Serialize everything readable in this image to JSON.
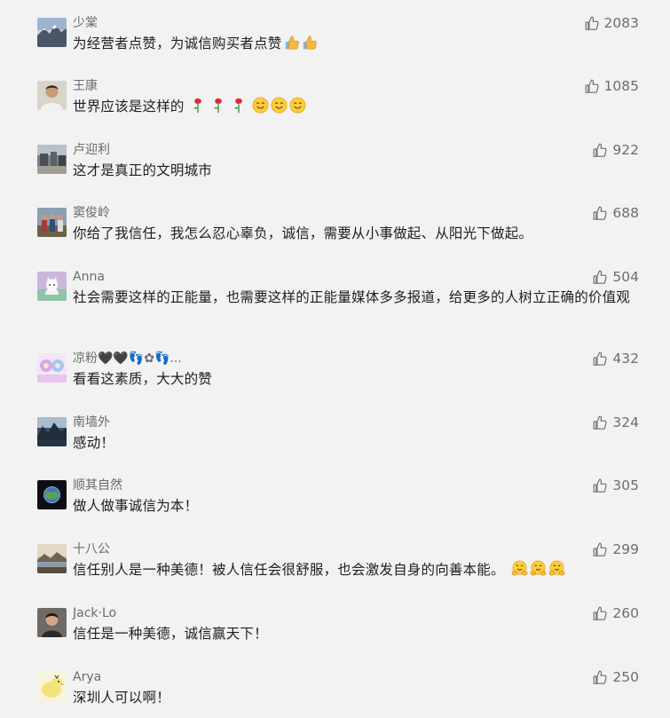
{
  "icons": {
    "like": "thumbs-up-icon"
  },
  "colors": {
    "background": "#f2f2f2",
    "name_text": "#6b6b6b",
    "like_count": "#6d6d6d"
  },
  "comments": [
    {
      "name": "少棠",
      "text": "为经营者点赞，为诚信购买者点赞",
      "emojis": [
        "thumbs-up-emoji",
        "thumbs-up-emoji"
      ],
      "likes": "2083"
    },
    {
      "name": "王康",
      "text": "世界应该是这样的",
      "emojis": [
        "rose-emoji",
        "rose-emoji",
        "rose-emoji",
        "smiley-emoji",
        "smiley-emoji",
        "smiley-emoji"
      ],
      "likes": "1085"
    },
    {
      "name": "卢迎利",
      "text": "这才是真正的文明城市",
      "likes": "922"
    },
    {
      "name": "窦俊岭",
      "text": "你给了我信任，我怎么忍心辜负，诚信，需要从小事做起、从阳光下做起。",
      "likes": "688"
    },
    {
      "name": "Anna",
      "text": "社会需要这样的正能量，也需要这样的正能量媒体多多报道，给更多的人树立正确的价值观",
      "likes": "504"
    },
    {
      "name": "凉粉🖤🖤👣✿👣...",
      "text": "看看这素质，大大的赞",
      "likes": "432"
    },
    {
      "name": "南墙外",
      "text": "感动！",
      "likes": "324"
    },
    {
      "name": "顺其自然",
      "text": "做人做事诚信为本！",
      "likes": "305"
    },
    {
      "name": "十八公",
      "text": "信任别人是一种美德！被人信任会很舒服，也会激发自身的向善本能。",
      "emojis": [
        "hug-emoji",
        "hug-emoji",
        "hug-emoji"
      ],
      "likes": "299"
    },
    {
      "name": "Jack·Lo",
      "text": "信任是一种美德，诚信赢天下！",
      "likes": "260"
    },
    {
      "name": "Arya",
      "text": "深圳人可以啊！",
      "likes": "250"
    }
  ]
}
